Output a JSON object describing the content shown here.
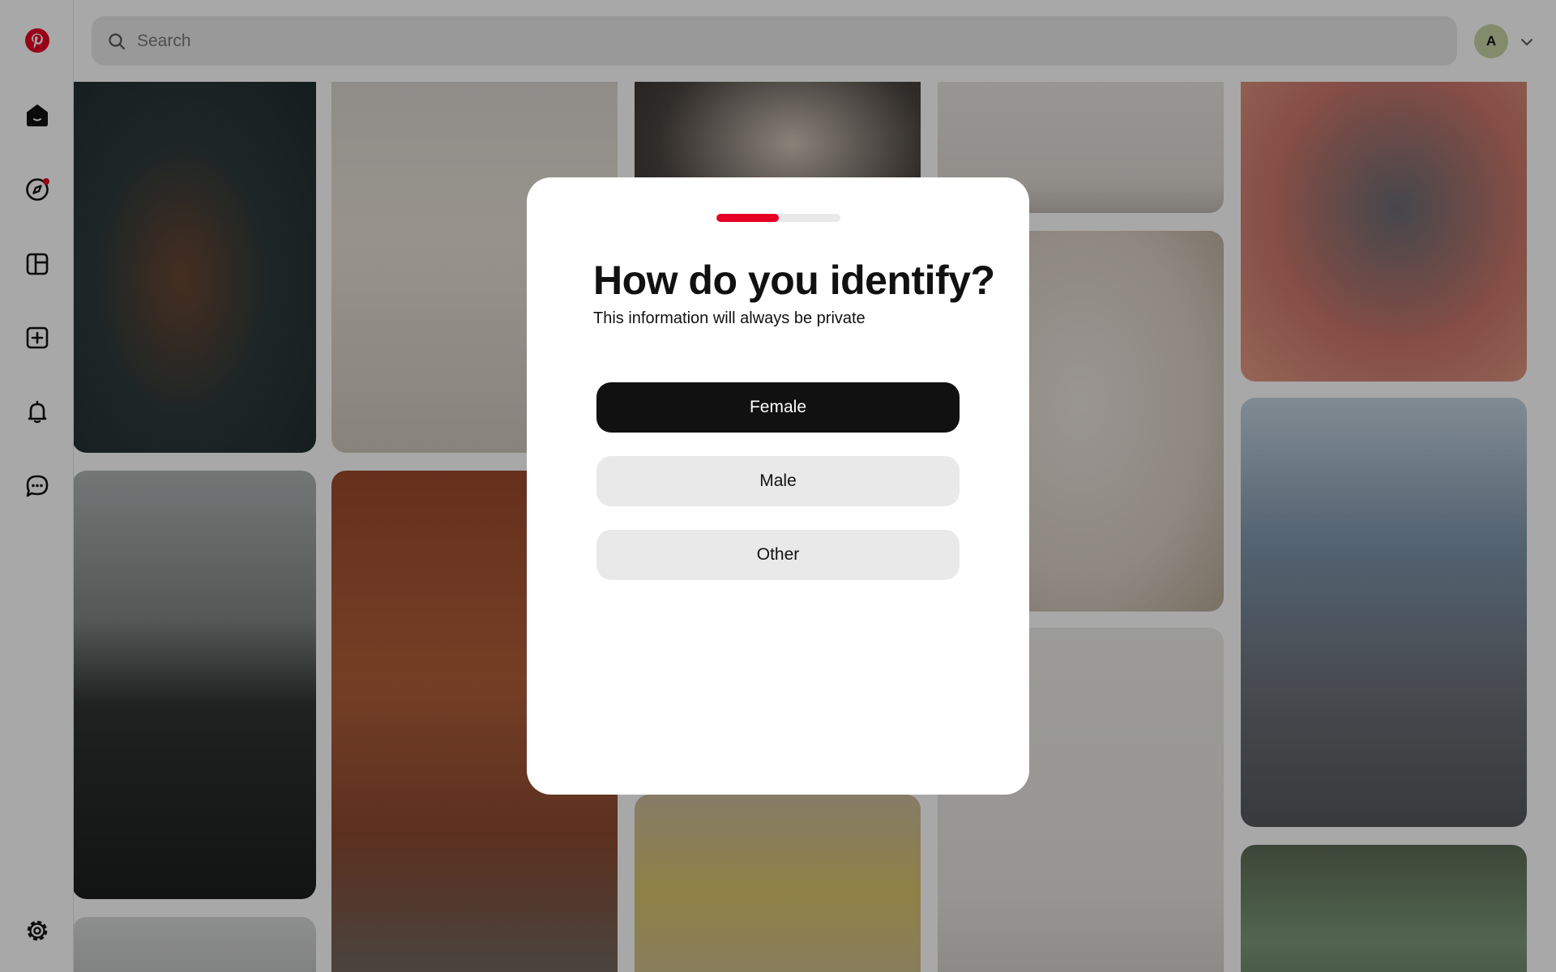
{
  "header": {
    "search_placeholder": "Search",
    "avatar_initial": "A"
  },
  "sidebar": {
    "items": [
      {
        "name": "home",
        "icon": "home-icon"
      },
      {
        "name": "explore",
        "icon": "compass-icon",
        "has_notification_dot": true
      },
      {
        "name": "boards",
        "icon": "boards-icon"
      },
      {
        "name": "create",
        "icon": "plus-square-icon"
      },
      {
        "name": "notifications",
        "icon": "bell-icon"
      },
      {
        "name": "messages",
        "icon": "chat-icon"
      },
      {
        "name": "settings",
        "icon": "gear-icon"
      }
    ]
  },
  "modal": {
    "progress_fraction": 0.5,
    "title": "How do you identify?",
    "subtitle": "This information will always be private",
    "options": [
      {
        "label": "Female",
        "style": "primary"
      },
      {
        "label": "Male",
        "style": "secondary"
      },
      {
        "label": "Other",
        "style": "secondary"
      }
    ]
  },
  "colors": {
    "brand_red": "#e60023",
    "primary_button": "#111111",
    "secondary_button": "#e9e9e9",
    "avatar_bg": "#c7d3a6"
  }
}
